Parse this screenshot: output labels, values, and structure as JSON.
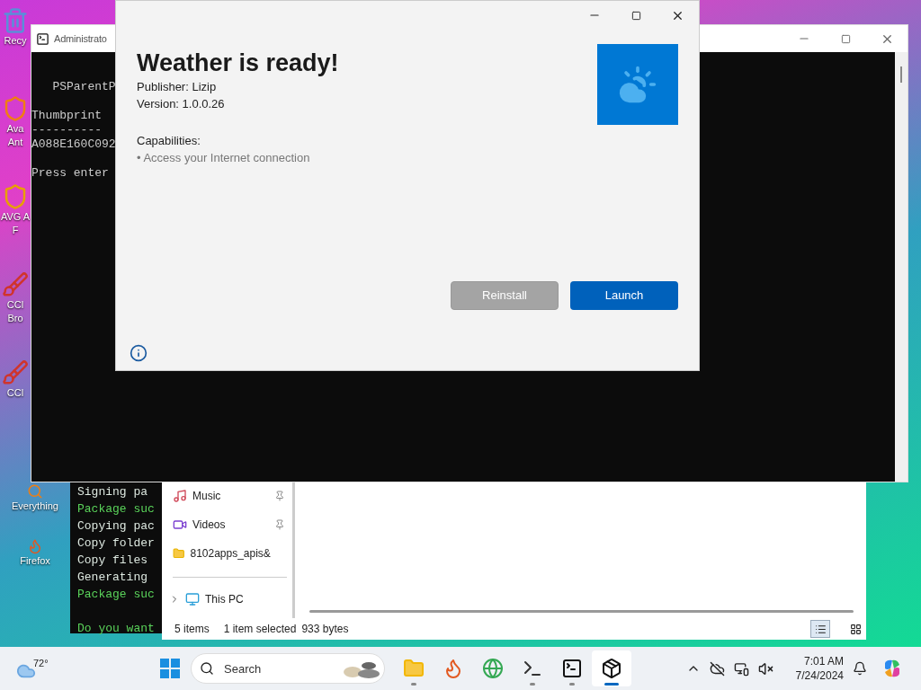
{
  "desktop_icons": [
    {
      "kind": "bin",
      "lines": [
        "Recy"
      ]
    },
    {
      "kind": "avast",
      "lines": [
        "Ava",
        "Ant"
      ]
    },
    {
      "kind": "avg",
      "lines": [
        "AVG A",
        "F"
      ]
    },
    {
      "kind": "ccleaner",
      "lines": [
        "CCl",
        "Bro"
      ]
    },
    {
      "kind": "ccleaner",
      "lines": [
        "CCl"
      ]
    },
    {
      "kind": "everything",
      "lines": [
        "Everything"
      ]
    },
    {
      "kind": "firefox",
      "lines": [
        "Firefox"
      ]
    }
  ],
  "terminal": {
    "blocks": [
      [
        {
          "text": "Signing pa",
          "kind": "normal"
        },
        {
          "text": "Package suc",
          "kind": "success"
        },
        {
          "text": "Copying pac",
          "kind": "normal"
        },
        {
          "text": "Copy folder",
          "kind": "normal"
        },
        {
          "text": "Copy files",
          "kind": "normal"
        },
        {
          "text": "Generating",
          "kind": "normal"
        },
        {
          "text": "Package suc",
          "kind": "success"
        }
      ],
      [
        {
          "text": "Do you want",
          "kind": "success"
        }
      ]
    ]
  },
  "explorer": {
    "nav": [
      {
        "label": "Music",
        "kind": "music",
        "pinned": true
      },
      {
        "label": "Videos",
        "kind": "videos",
        "pinned": true
      },
      {
        "label": "8102apps_apis&",
        "kind": "folder",
        "pinned": false
      }
    ],
    "this_pc": "This PC",
    "status": [
      "5 items",
      "1 item selected",
      "933 bytes"
    ],
    "views": [
      {
        "kind": "details",
        "selected": true
      },
      {
        "kind": "tiles",
        "selected": false
      }
    ]
  },
  "cmd": {
    "title": "Administrato",
    "blocks": [
      [
        "   PSParentP"
      ],
      [
        "Thumbprint",
        "----------",
        "A088E160C092"
      ],
      [
        "Press enter"
      ]
    ]
  },
  "dialog": {
    "title": "Weather is ready!",
    "publisher": "Publisher: Lizip",
    "version": "Version: 1.0.0.26",
    "capabilities_label": "Capabilities:",
    "capabilities": [
      "• Access your Internet connection"
    ],
    "buttons": [
      {
        "label": "Reinstall",
        "primary": false,
        "disabled": true
      },
      {
        "label": "Launch",
        "primary": true,
        "disabled": false
      }
    ]
  },
  "taskbar": {
    "weather": "72°",
    "search": {
      "placeholder": "Search"
    },
    "apps": [
      {
        "kind": "explorer",
        "running": true,
        "active": false
      },
      {
        "kind": "firefox",
        "running": false,
        "active": false
      },
      {
        "kind": "chrome",
        "running": false,
        "active": false
      },
      {
        "kind": "terminal",
        "running": true,
        "active": false
      },
      {
        "kind": "cmd",
        "running": true,
        "active": false
      },
      {
        "kind": "package",
        "running": true,
        "active": true
      }
    ],
    "time": "7:01 AM",
    "date": "7/24/2024"
  }
}
